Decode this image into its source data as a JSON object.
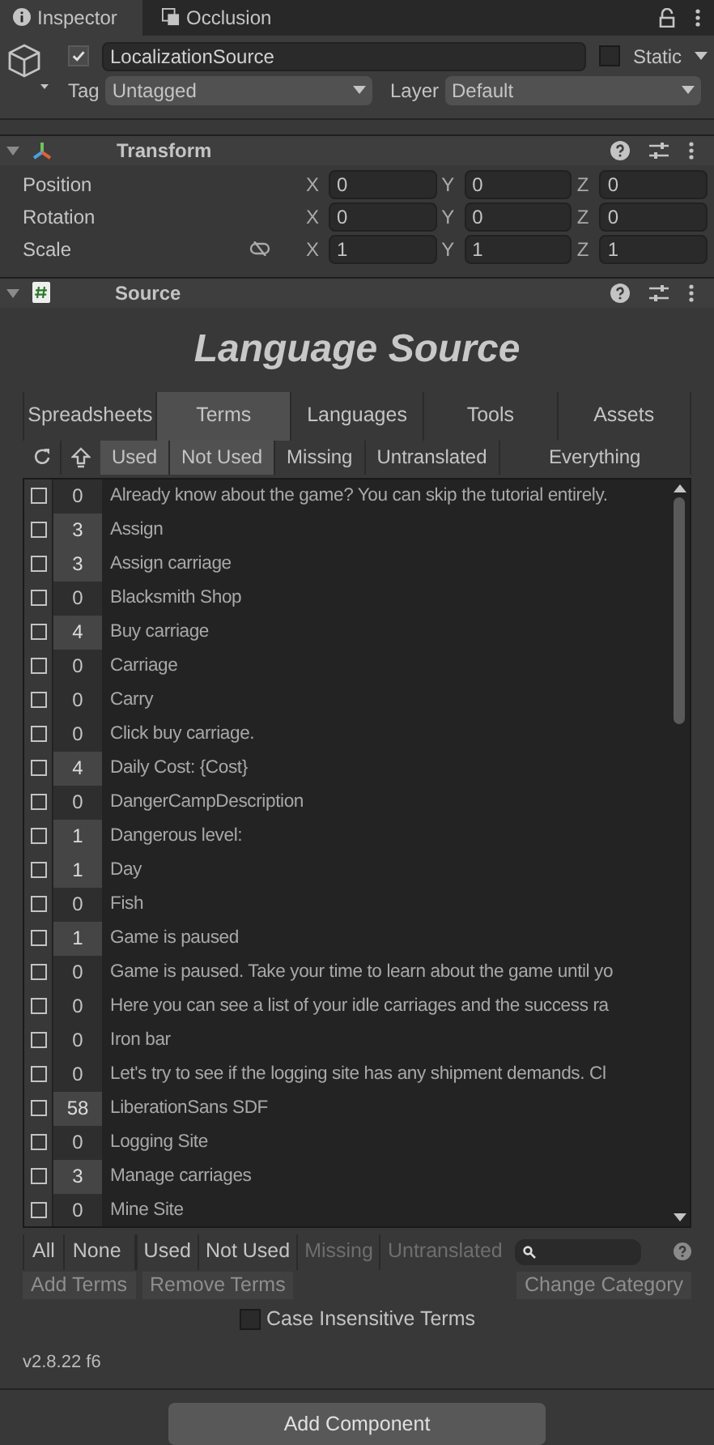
{
  "window_tabs": [
    {
      "label": "Inspector",
      "selected": true
    },
    {
      "label": "Occlusion",
      "selected": false
    }
  ],
  "game_object": {
    "active": true,
    "name": "LocalizationSource",
    "static_label": "Static",
    "static": false,
    "tag_label": "Tag",
    "tag": "Untagged",
    "layer_label": "Layer",
    "layer": "Default"
  },
  "transform": {
    "title": "Transform",
    "expanded": true,
    "rows": [
      {
        "label": "Position",
        "constrained": false,
        "fields": [
          {
            "axis": "X",
            "value": "0"
          },
          {
            "axis": "Y",
            "value": "0"
          },
          {
            "axis": "Z",
            "value": "0"
          }
        ]
      },
      {
        "label": "Rotation",
        "constrained": false,
        "fields": [
          {
            "axis": "X",
            "value": "0"
          },
          {
            "axis": "Y",
            "value": "0"
          },
          {
            "axis": "Z",
            "value": "0"
          }
        ]
      },
      {
        "label": "Scale",
        "constrained": true,
        "fields": [
          {
            "axis": "X",
            "value": "1"
          },
          {
            "axis": "Y",
            "value": "1"
          },
          {
            "axis": "Z",
            "value": "1"
          }
        ]
      }
    ]
  },
  "source": {
    "title": "Source",
    "expanded": true,
    "heading": "Language Source",
    "tabs": [
      {
        "label": "Spreadsheets",
        "selected": false
      },
      {
        "label": "Terms",
        "selected": true
      },
      {
        "label": "Languages",
        "selected": false
      },
      {
        "label": "Tools",
        "selected": false
      },
      {
        "label": "Assets",
        "selected": false
      }
    ],
    "filters": [
      {
        "label": "Used",
        "selected": true
      },
      {
        "label": "Not Used",
        "selected": true
      },
      {
        "label": "Missing",
        "selected": false
      },
      {
        "label": "Untranslated",
        "selected": false
      },
      {
        "label": "Everything",
        "selected": false
      }
    ],
    "terms": [
      {
        "checked": false,
        "count": "0",
        "name": "Already know about the game? You can skip the tutorial entirely."
      },
      {
        "checked": false,
        "count": "3",
        "name": "Assign"
      },
      {
        "checked": false,
        "count": "3",
        "name": "Assign carriage"
      },
      {
        "checked": false,
        "count": "0",
        "name": "Blacksmith Shop"
      },
      {
        "checked": false,
        "count": "4",
        "name": "Buy carriage"
      },
      {
        "checked": false,
        "count": "0",
        "name": "Carriage"
      },
      {
        "checked": false,
        "count": "0",
        "name": "Carry"
      },
      {
        "checked": false,
        "count": "0",
        "name": "Click buy carriage."
      },
      {
        "checked": false,
        "count": "4",
        "name": "Daily Cost: {Cost}"
      },
      {
        "checked": false,
        "count": "0",
        "name": "DangerCampDescription"
      },
      {
        "checked": false,
        "count": "1",
        "name": "Dangerous level:"
      },
      {
        "checked": false,
        "count": "1",
        "name": "Day"
      },
      {
        "checked": false,
        "count": "0",
        "name": "Fish"
      },
      {
        "checked": false,
        "count": "1",
        "name": "Game is paused"
      },
      {
        "checked": false,
        "count": "0",
        "name": "Game is paused. Take your time to learn about the game until yo"
      },
      {
        "checked": false,
        "count": "0",
        "name": "Here you can see a list of your idle carriages and the success ra"
      },
      {
        "checked": false,
        "count": "0",
        "name": "Iron bar"
      },
      {
        "checked": false,
        "count": "0",
        "name": "Let's try to see if the logging site has any shipment demands. Cl"
      },
      {
        "checked": false,
        "count": "58",
        "name": "LiberationSans SDF"
      },
      {
        "checked": false,
        "count": "0",
        "name": "Logging Site"
      },
      {
        "checked": false,
        "count": "3",
        "name": "Manage carriages"
      },
      {
        "checked": false,
        "count": "0",
        "name": "Mine Site"
      }
    ],
    "select_buttons": [
      "All",
      "None"
    ],
    "bottom_filters": [
      {
        "label": "Used",
        "disabled": false
      },
      {
        "label": "Not Used",
        "disabled": false
      },
      {
        "label": "Missing",
        "disabled": true
      },
      {
        "label": "Untranslated",
        "disabled": true
      }
    ],
    "actions": [
      "Add Terms",
      "Remove Terms",
      "Change Category"
    ],
    "case_insensitive": {
      "label": "Case Insensitive Terms",
      "checked": false
    },
    "version": "v2.8.22 f6"
  },
  "add_component": "Add Component"
}
